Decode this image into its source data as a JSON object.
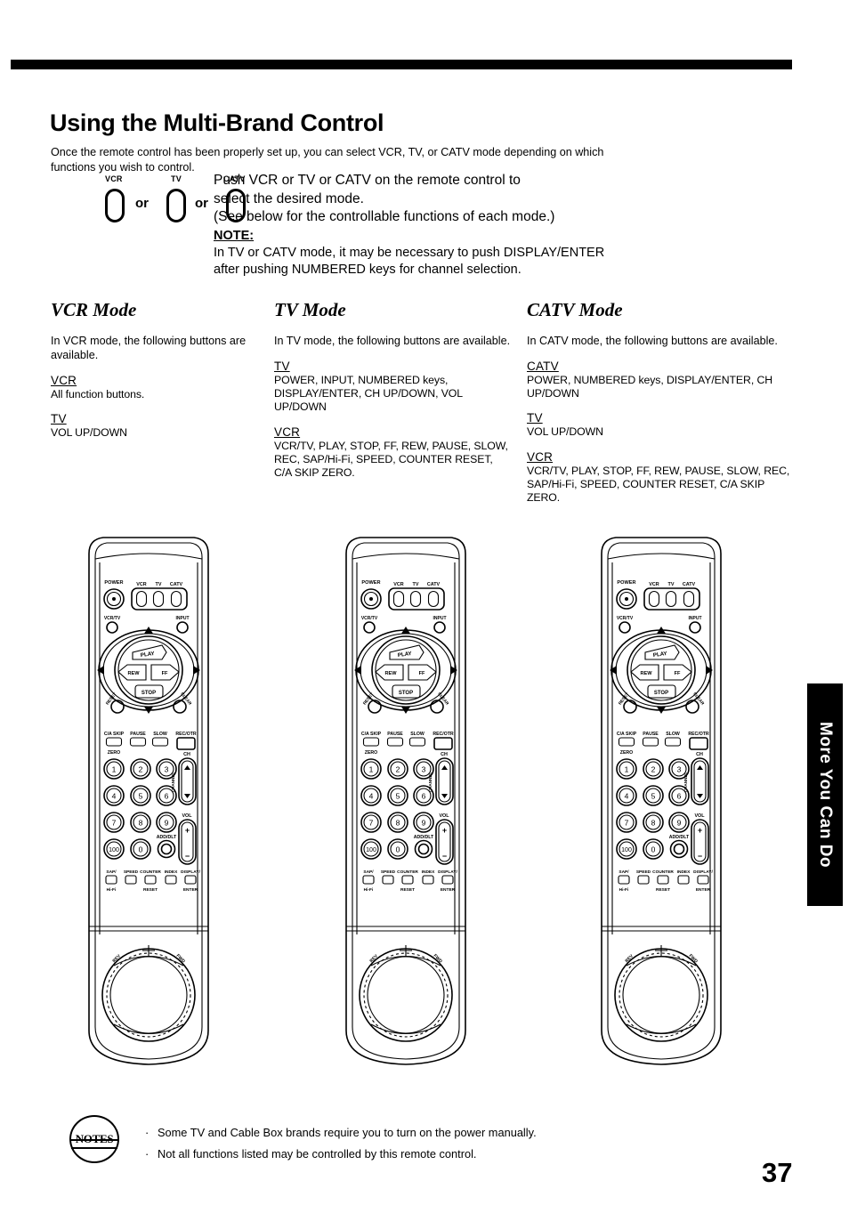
{
  "header": {
    "title": "Using the Multi-Brand Control",
    "intro": "Once the remote control has been properly set up, you can select VCR, TV, or CATV mode depending on which functions you wish to control."
  },
  "mode_select": {
    "keys": [
      {
        "label": "VCR"
      },
      {
        "label": "TV"
      },
      {
        "label": "CATV"
      }
    ],
    "separator": "or",
    "instruction_line1": "Push VCR or TV  or CATV on the remote control to",
    "instruction_line2": "select the desired mode.",
    "instruction_line3": "(See below for the controllable functions of each mode.)",
    "note_heading": "NOTE:",
    "note_line1": "In TV or CATV mode, it may be necessary to push DISPLAY/ENTER",
    "note_line2": "after pushing NUMBERED keys for channel selection."
  },
  "modes": [
    {
      "title": "VCR Mode",
      "intro": "In VCR mode, the following buttons are available.",
      "groups": [
        {
          "title": "VCR",
          "body": "All function buttons."
        },
        {
          "title": "TV",
          "body": "VOL UP/DOWN"
        }
      ]
    },
    {
      "title": "TV Mode",
      "intro": "In TV mode, the following buttons are available.",
      "groups": [
        {
          "title": "TV",
          "body": "POWER, INPUT, NUMBERED keys, DISPLAY/ENTER, CH UP/DOWN, VOL UP/DOWN"
        },
        {
          "title": "VCR",
          "body": "VCR/TV, PLAY, STOP, FF, REW, PAUSE, SLOW, REC, SAP/Hi-Fi, SPEED, COUNTER RESET, C/A SKIP ZERO."
        }
      ]
    },
    {
      "title": "CATV Mode",
      "intro": "In CATV mode, the following buttons are available.",
      "groups": [
        {
          "title": "CATV",
          "body": "POWER, NUMBERED keys, DISPLAY/ENTER, CH UP/DOWN"
        },
        {
          "title": "TV",
          "body": "VOL UP/DOWN"
        },
        {
          "title": "VCR",
          "body": "VCR/TV, PLAY, STOP, FF, REW, PAUSE, SLOW, REC, SAP/Hi-Fi, SPEED, COUNTER RESET, C/A SKIP ZERO."
        }
      ]
    }
  ],
  "remote": {
    "power": "POWER",
    "mode_keys": [
      "VCR",
      "TV",
      "CATV"
    ],
    "vcrtv": "VCR/TV",
    "input": "INPUT",
    "play": "PLAY",
    "rew": "REW",
    "ff": "FF",
    "stop": "STOP",
    "reset_left": "RESET",
    "reset_right": "CLEAR",
    "transport_row": [
      "C/A SKIP",
      "PAUSE",
      "SLOW",
      "REC/OTR"
    ],
    "zero": "ZERO",
    "numbers": [
      "1",
      "2",
      "3",
      "4",
      "5",
      "6",
      "7",
      "8",
      "9",
      "100",
      "0"
    ],
    "add_dlt": "ADD/DLT",
    "ch": "CH",
    "ch_channel": "CHANNEL",
    "vol": "VOL",
    "vol_plus": "+",
    "vol_minus": "−",
    "bottom_row": [
      "SAP/",
      "SPEED",
      "COUNTER",
      "INDEX",
      "DISPLAY/"
    ],
    "bottom_row_sub": [
      "Hi-Fi",
      "RESET",
      "ENTER"
    ],
    "dial_left": "REV",
    "dial_right": "FWD"
  },
  "side_tab": {
    "label": "More You Can Do"
  },
  "notes": {
    "badge": "NOTES",
    "items": [
      "Some TV and Cable Box brands require you to turn on the power manually.",
      "Not all functions listed may be controlled by this remote control."
    ]
  },
  "page_number": "37"
}
